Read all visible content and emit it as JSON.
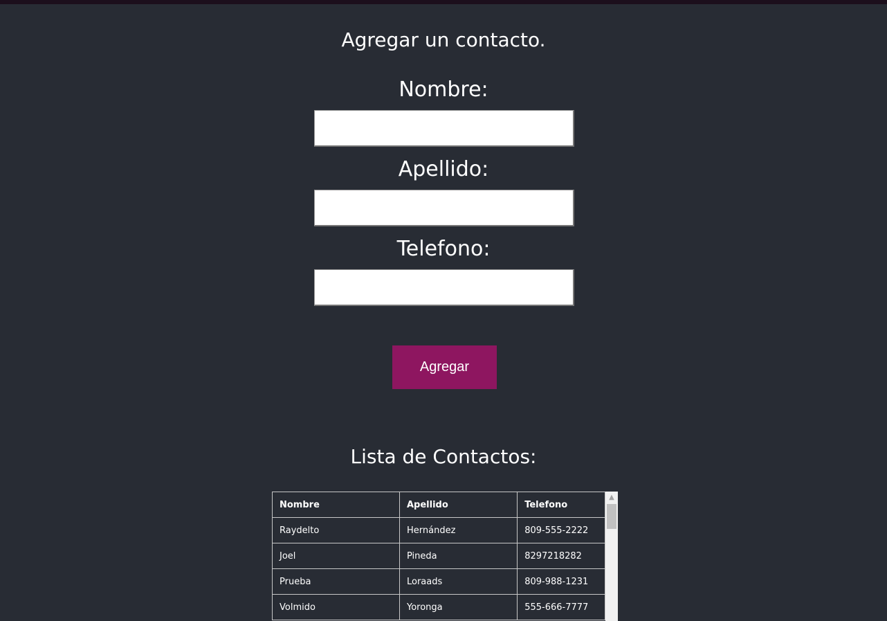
{
  "form": {
    "title": "Agregar un contacto.",
    "fields": [
      {
        "label": "Nombre:",
        "value": "",
        "placeholder": ""
      },
      {
        "label": "Apellido:",
        "value": "",
        "placeholder": ""
      },
      {
        "label": "Telefono:",
        "value": "",
        "placeholder": ""
      }
    ],
    "submit_label": "Agregar",
    "submit_color": "#8e1660"
  },
  "list": {
    "title": "Lista de Contactos:",
    "columns": [
      "Nombre",
      "Apellido",
      "Telefono"
    ],
    "rows": [
      [
        "Raydelto",
        "Hernández",
        "809-555-2222"
      ],
      [
        "Joel",
        "Pineda",
        "8297218282"
      ],
      [
        "Prueba",
        "Loraads",
        "809-988-1231"
      ],
      [
        "Volmido",
        "Yoronga",
        "555-666-7777"
      ]
    ]
  },
  "icons": {
    "scroll_up": "chevron-up-icon"
  },
  "colors": {
    "background": "#282c34",
    "text": "#ffffff"
  }
}
